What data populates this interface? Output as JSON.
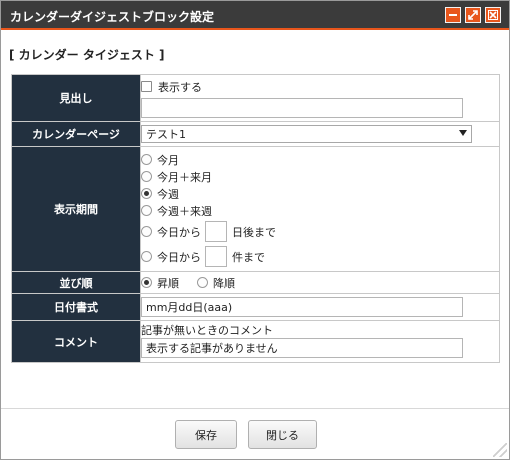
{
  "window": {
    "title": "カレンダーダイジェストブロック設定",
    "accent": "#e8561c",
    "titlebar_color": "#3b3b3b",
    "controls": [
      {
        "name": "minimize-icon"
      },
      {
        "name": "maximize-icon"
      },
      {
        "name": "close-icon"
      }
    ]
  },
  "section_title": "[ カレンダー タイジェスト ]",
  "form": {
    "label_bg": "#22303f",
    "heading": {
      "label": "見出し",
      "checkbox_label": "表示する",
      "checked": false,
      "input_value": ""
    },
    "calendar_page": {
      "label": "カレンダーページ",
      "selected": "テスト1"
    },
    "period": {
      "label": "表示期間",
      "options": [
        "今月",
        "今月＋来月",
        "今週",
        "今週＋来週"
      ],
      "selected": "今週",
      "days_after": {
        "prefix": "今日から",
        "suffix": "日後まで",
        "value": ""
      },
      "count_until": {
        "prefix": "今日から",
        "suffix": "件まで",
        "value": ""
      }
    },
    "order": {
      "label": "並び順",
      "asc": "昇順",
      "desc": "降順",
      "selected": "昇順"
    },
    "date_format": {
      "label": "日付書式",
      "value": "mm月dd日(aaa)"
    },
    "comment": {
      "label": "コメント",
      "caption": "記事が無いときのコメント",
      "value": "表示する記事がありません"
    }
  },
  "buttons": {
    "save": "保存",
    "close": "閉じる"
  }
}
